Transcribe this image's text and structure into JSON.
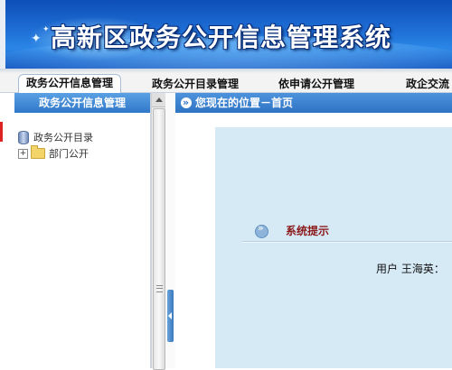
{
  "header": {
    "title": "高新区政务公开信息管理系统"
  },
  "nav": {
    "tabs": [
      {
        "label": "政务公开信息管理",
        "active": true
      },
      {
        "label": "政务公开目录管理",
        "active": false
      },
      {
        "label": "依申请公开管理",
        "active": false
      },
      {
        "label": "政企交流",
        "active": false
      }
    ]
  },
  "sidebar": {
    "header": "政务公开信息管理",
    "tree_root": "政务公开目录",
    "tree_items": [
      {
        "label": "部门公开",
        "expand_symbol": "+"
      }
    ]
  },
  "main": {
    "location": "您现在的位置－首页",
    "system_tip_title": "系统提示",
    "user_text": "用户 王海英："
  },
  "colors": {
    "banner_blue": "#1f6fd6",
    "panel_header_blue": "#2f78c9",
    "content_bg": "#d6eaf6",
    "tip_title": "#8b1a1a"
  },
  "icons": [
    "star-icon",
    "database-icon",
    "folder-icon",
    "expand-icon",
    "arrow-icon",
    "scroll-up-icon",
    "collapse-icon"
  ]
}
